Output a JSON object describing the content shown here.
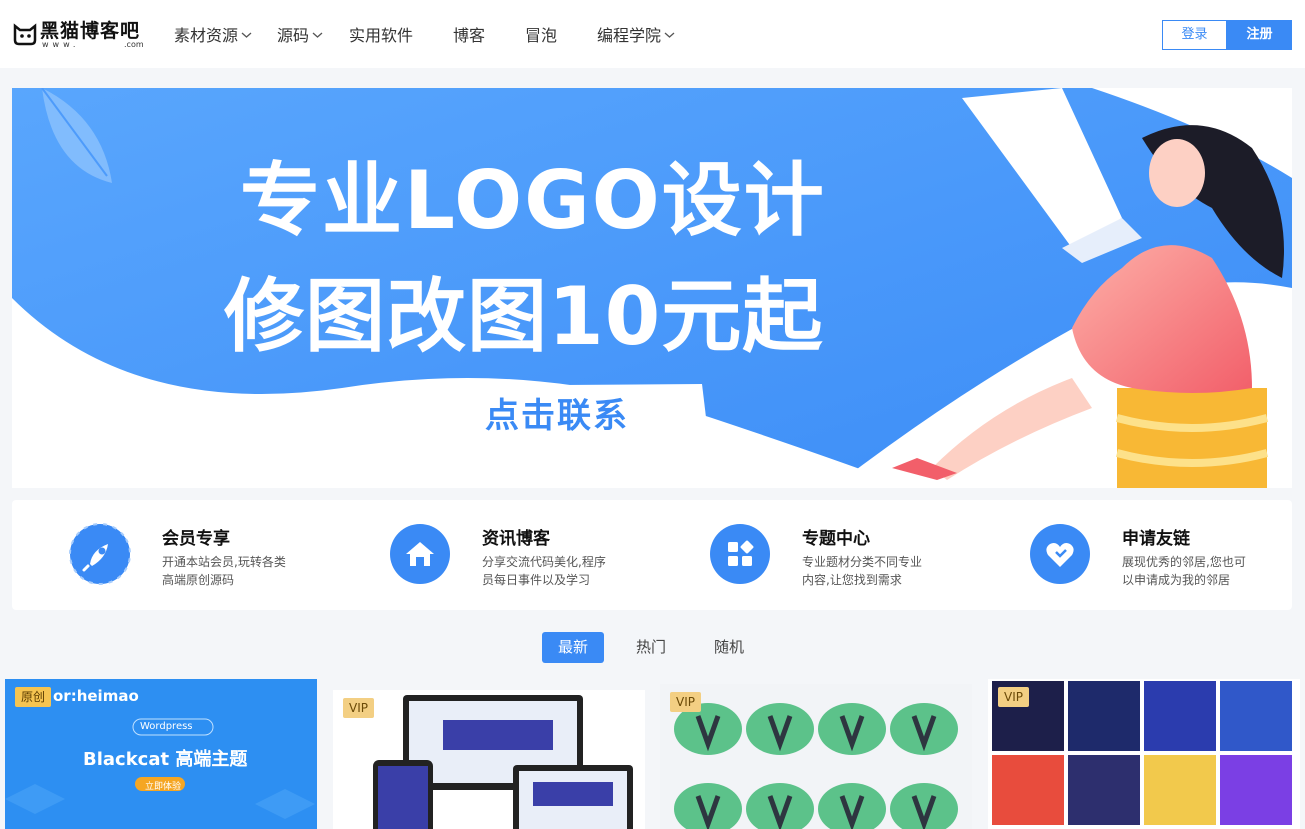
{
  "header": {
    "logo_text": "黑猫博客吧",
    "logo_sub": "www.",
    "logo_sub2": ".com",
    "nav": [
      {
        "label": "素材资源",
        "dropdown": true
      },
      {
        "label": "源码",
        "dropdown": true
      },
      {
        "label": "实用软件",
        "dropdown": false
      },
      {
        "label": "博客",
        "dropdown": false
      },
      {
        "label": "冒泡",
        "dropdown": false
      },
      {
        "label": "编程学院",
        "dropdown": true
      }
    ],
    "login_label": "登录",
    "register_label": "注册"
  },
  "banner": {
    "line1": "专业LOGO设计",
    "line2": "修图改图10元起",
    "cta": "点击联系"
  },
  "features": [
    {
      "title": "会员专享",
      "desc": "开通本站会员,玩转各类高端原创源码",
      "icon": "rocket-icon"
    },
    {
      "title": "资讯博客",
      "desc": "分享交流代码美化,程序员每日事件以及学习",
      "icon": "home-icon"
    },
    {
      "title": "专题中心",
      "desc": "专业题材分类不同专业内容,让您找到需求",
      "icon": "grid-icon"
    },
    {
      "title": "申请友链",
      "desc": "展现优秀的邻居,您也可以申请成为我的邻居",
      "icon": "heart-icon"
    }
  ],
  "tabs": [
    {
      "label": "最新",
      "active": true
    },
    {
      "label": "热门",
      "active": false
    },
    {
      "label": "随机",
      "active": false
    }
  ],
  "cards": [
    {
      "badge": "原创",
      "thumb_title": "or:heimao",
      "thumb_tag": "Wordpress",
      "thumb_heading": "Blackcat 高端主题",
      "thumb_button": "立即体验"
    },
    {
      "badge": "VIP"
    },
    {
      "badge": "VIP"
    },
    {
      "badge": "VIP"
    }
  ],
  "colors": {
    "accent": "#3a8af5",
    "banner_bg": "#4d9bfb",
    "badge_yellow": "#f5c451",
    "badge_gold": "#f3cf83"
  }
}
